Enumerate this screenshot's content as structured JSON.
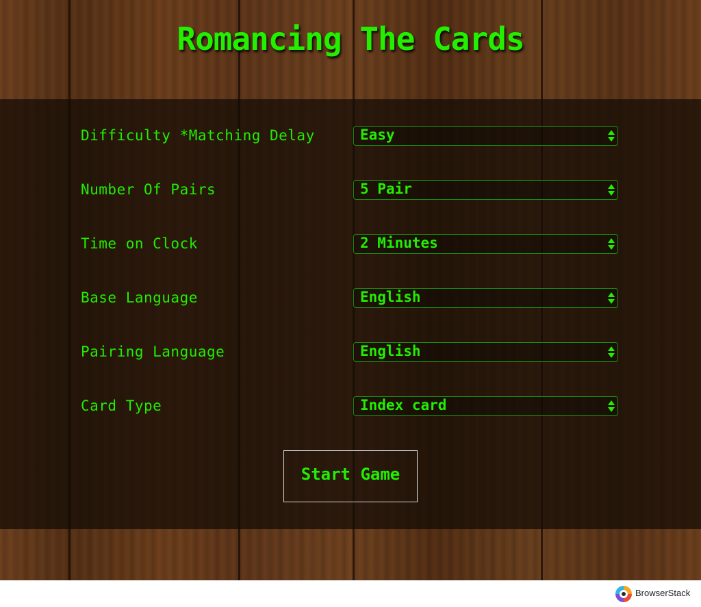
{
  "title": "Romancing The Cards",
  "settings": [
    {
      "label": "Difficulty *Matching Delay",
      "value": "Easy"
    },
    {
      "label": "Number Of Pairs",
      "value": "5 Pair"
    },
    {
      "label": "Time on Clock",
      "value": "2 Minutes"
    },
    {
      "label": "Base Language",
      "value": "English"
    },
    {
      "label": "Pairing Language",
      "value": "English"
    },
    {
      "label": "Card Type",
      "value": "Index card"
    }
  ],
  "start_button": "Start Game",
  "footer": {
    "brand": "BrowserStack",
    "logo_icon": "browserstack-logo-icon"
  },
  "colors": {
    "accent_green": "#22ee00",
    "wood_brown": "#5a3519",
    "panel_overlay": "#140c05"
  }
}
